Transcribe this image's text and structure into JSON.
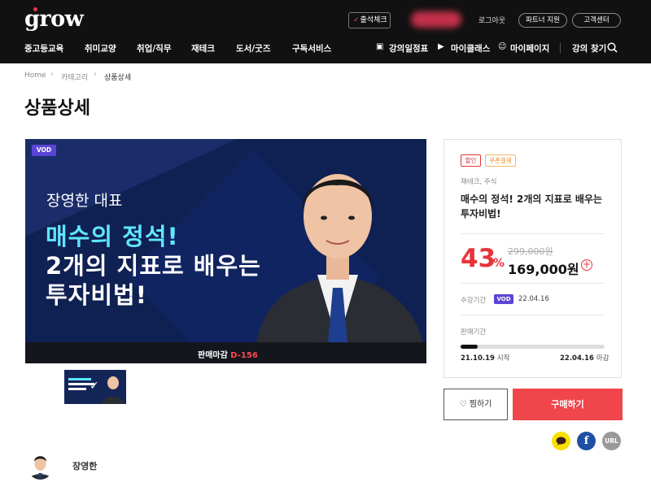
{
  "header": {
    "logo": "grow",
    "attendance_label": "출석체크",
    "logout": "로그아웃",
    "partner": "파트너 지원",
    "support": "고객센터",
    "nav": [
      "중고등교육",
      "취미교양",
      "취업/직무",
      "재테크",
      "도서/굿즈",
      "구독서비스"
    ],
    "right_nav": {
      "schedule": "강의일정표",
      "myclass": "마이클래스",
      "mypage": "마이페이지",
      "search": "강의 찾기"
    }
  },
  "breadcrumb": [
    "Home",
    "카테고리",
    "상품상세"
  ],
  "page_title": "상품상세",
  "banner": {
    "vod": "VOD",
    "line1": "장영한 대표",
    "line2": "매수의 정석!",
    "line3": "2개의 지표로 배우는",
    "line4": "투자비법!",
    "deadline_label": "판매마감",
    "deadline_value": "D-156"
  },
  "product": {
    "tags": [
      "할인",
      "쿠폰결제"
    ],
    "category": "재테크, 주식",
    "title": "매수의 정석! 2개의 지표로 배우는 투자비법!",
    "discount": "43",
    "discount_unit": "%",
    "original_price": "299,000원",
    "price": "169,000원",
    "period_label": "수강기간",
    "period_type": "VOD",
    "period_value": "22.04.16",
    "sale_label": "판매기간",
    "sale_start": "21.10.19",
    "sale_start_suffix": "시작",
    "sale_end": "22.04.16",
    "sale_end_suffix": "마감",
    "sale_progress": 0.12
  },
  "actions": {
    "wish": "찜하기",
    "buy": "구매하기",
    "share_url": "URL"
  },
  "instructor": {
    "name": "장영한"
  }
}
